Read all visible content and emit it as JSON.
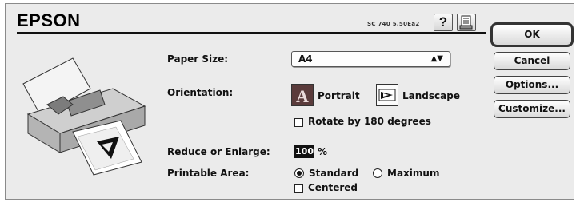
{
  "header": {
    "brand": "EPSON",
    "model": "SC 740 5.50Ea2"
  },
  "icons": {
    "help": "question-mark-icon",
    "config": "printer-config-icon"
  },
  "settings": {
    "paper_size_label": "Paper Size:",
    "paper_size_value": "A4",
    "orientation_label": "Orientation:",
    "portrait_label": "Portrait",
    "landscape_label": "Landscape",
    "portrait_selected": true,
    "rotate_label": "Rotate by 180 degrees",
    "rotate_checked": false,
    "reduce_label": "Reduce or Enlarge:",
    "reduce_value": "100",
    "reduce_unit": "%",
    "printable_area_label": "Printable Area:",
    "standard_label": "Standard",
    "maximum_label": "Maximum",
    "printable_area_selected": "Standard",
    "centered_label": "Centered",
    "centered_checked": false
  },
  "buttons": {
    "ok": "OK",
    "cancel": "Cancel",
    "options": "Options...",
    "customize": "Customize..."
  }
}
